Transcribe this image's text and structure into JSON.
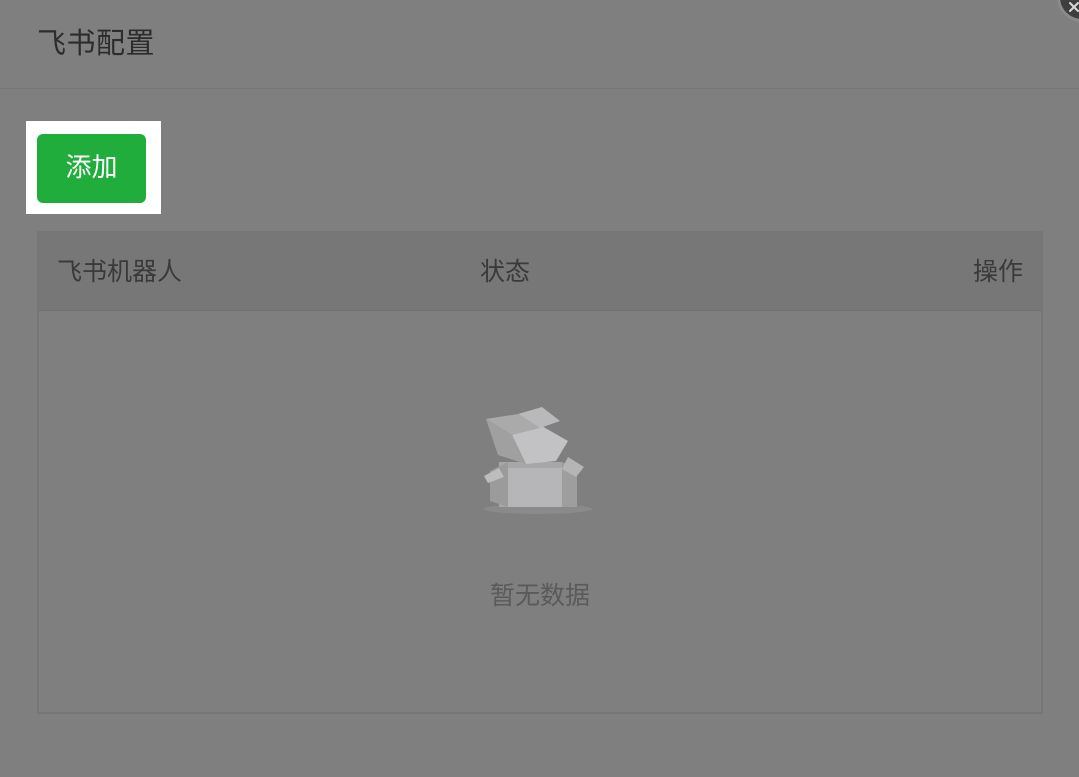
{
  "dialog": {
    "title": "飞书配置"
  },
  "toolbar": {
    "add_label": "添加",
    "add_color": "#20ad3c"
  },
  "table": {
    "columns": [
      "飞书机器人",
      "状态",
      "操作"
    ],
    "rows": [],
    "empty_text": "暂无数据",
    "empty_icon": "empty-box-icon"
  },
  "icons": {
    "close": "close-icon"
  }
}
